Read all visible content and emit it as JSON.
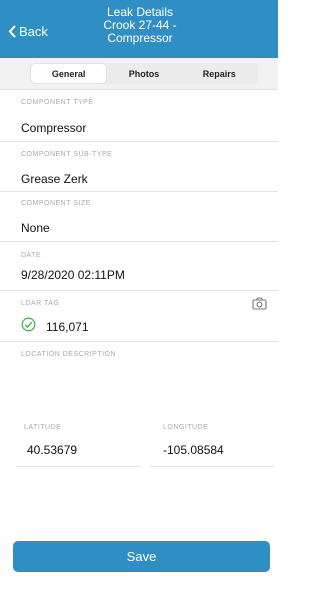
{
  "header": {
    "back_label": "Back",
    "title_line1": "Leak Details",
    "title_line2": "Crook 27-44 -",
    "title_line3": "Compressor"
  },
  "tabs": [
    {
      "label": "General",
      "active": true
    },
    {
      "label": "Photos",
      "active": false
    },
    {
      "label": "Repairs",
      "active": false
    }
  ],
  "fields": {
    "component_type": {
      "label": "COMPONENT TYPE",
      "value": "Compressor"
    },
    "component_sub_type": {
      "label": "COMPONENT SUB-TYPE",
      "value": "Grease Zerk"
    },
    "component_size": {
      "label": "COMPONENT SIZE",
      "value": "None"
    },
    "date": {
      "label": "DATE",
      "value": "9/28/2020 02:11PM"
    },
    "ldar_tag": {
      "label": "LDAR TAG",
      "value": "116,071"
    },
    "location_description": {
      "label": "LOCATION DESCRIPTION",
      "value": ""
    },
    "latitude": {
      "label": "LATITUDE",
      "value": "40.53679"
    },
    "longitude": {
      "label": "LONGITUDE",
      "value": "-105.08584"
    }
  },
  "save_label": "Save",
  "icons": {
    "back": "chevron-left-icon",
    "camera": "camera-icon",
    "check": "check-circle-icon"
  },
  "colors": {
    "header": "#2f8fc4",
    "save_button": "#2f8fc4",
    "check": "#4caf50"
  }
}
